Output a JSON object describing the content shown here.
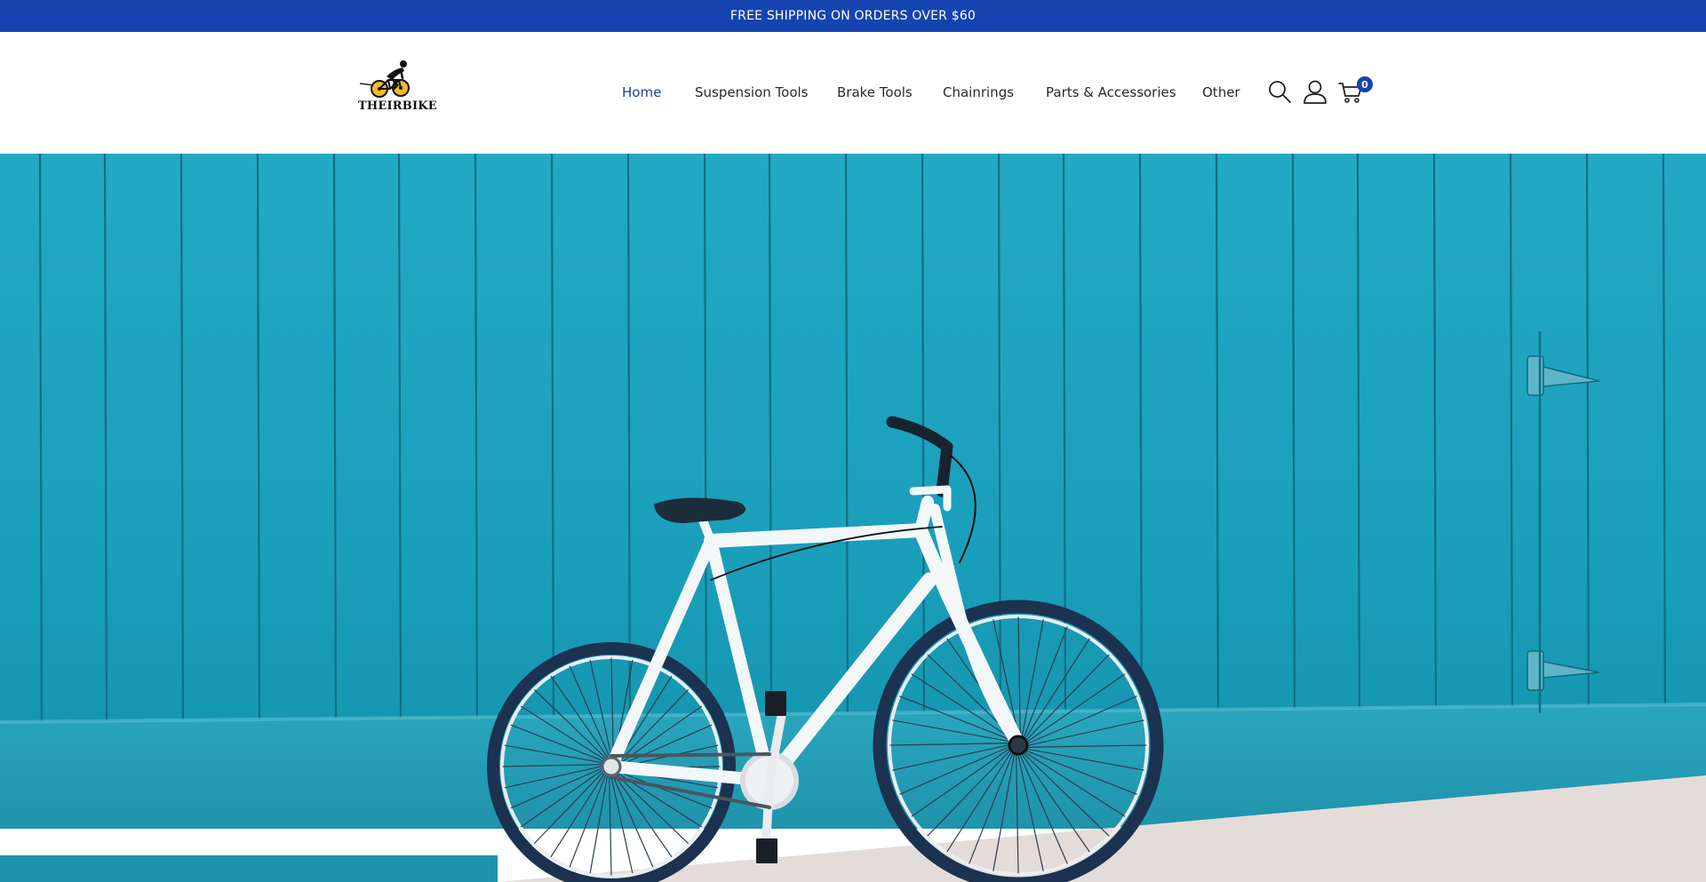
{
  "announcement": {
    "text": "FREE SHIPPING ON ORDERS OVER $60"
  },
  "brand": {
    "name": "THEIRBIKE"
  },
  "nav": {
    "items": [
      {
        "label": "Home",
        "active": true
      },
      {
        "label": "Suspension Tools",
        "active": false
      },
      {
        "label": "Brake Tools",
        "active": false
      },
      {
        "label": "Chainrings",
        "active": false
      },
      {
        "label": "Parts & Accessories",
        "active": false
      },
      {
        "label": "Other",
        "active": false
      }
    ]
  },
  "header_icons": {
    "search": "search-icon",
    "account": "user-icon",
    "cart": "cart-icon",
    "cart_count": "0"
  },
  "hero": {
    "image": "white fixed-gear bicycle leaning against a teal wooden wall"
  },
  "colors": {
    "accent": "#1544b0",
    "active_nav": "#1c3f99",
    "hero_wall": "#1fa3bd",
    "logo_wheel": "#f2b92b"
  }
}
